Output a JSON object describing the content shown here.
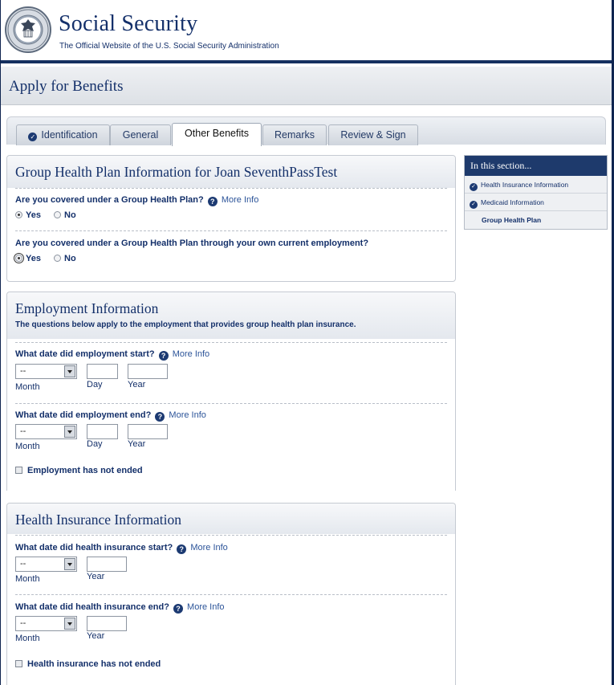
{
  "header": {
    "title": "Social Security",
    "subtitle": "The Official Website of the U.S. Social Security Administration",
    "seal_text": "SOCIAL SECURITY ADMINISTRATION",
    "seal_center": "USA"
  },
  "page": {
    "title": "Apply for Benefits"
  },
  "tabs": [
    {
      "label": "Identification",
      "completed": true
    },
    {
      "label": "General",
      "completed": false
    },
    {
      "label": "Other Benefits",
      "completed": false,
      "active": true
    },
    {
      "label": "Remarks",
      "completed": false
    },
    {
      "label": "Review & Sign",
      "completed": false
    }
  ],
  "group_health": {
    "heading": "Group Health Plan Information for Joan SeventhPassTest",
    "q1": "Are you covered under a Group Health Plan?",
    "q1_selected": "Yes",
    "q2": "Are you covered under a Group Health Plan through your own current employment?",
    "q2_selected": "Yes",
    "yes": "Yes",
    "no": "No",
    "more_info": "More Info"
  },
  "employment": {
    "heading": "Employment Information",
    "intro": "The questions below apply to the employment that provides group health plan insurance.",
    "start_q": "What date did employment start?",
    "end_q": "What date did employment end?",
    "more_info": "More Info",
    "month_value": "--",
    "month_label": "Month",
    "day_label": "Day",
    "year_label": "Year",
    "not_ended": "Employment has not ended"
  },
  "insurance": {
    "heading": "Health Insurance Information",
    "start_q": "What date did health insurance start?",
    "end_q": "What date did health insurance end?",
    "more_info": "More Info",
    "month_value": "--",
    "month_label": "Month",
    "year_label": "Year",
    "not_ended": "Health insurance has not ended"
  },
  "side_nav": {
    "heading": "In this section...",
    "items": [
      {
        "label": "Health Insurance Information",
        "completed": true
      },
      {
        "label": "Medicaid Information",
        "completed": true
      },
      {
        "label": "Group Health Plan",
        "current": true
      }
    ]
  },
  "colors": {
    "brand_navy": "#14306a",
    "accent_dark": "#1e3a6c"
  }
}
